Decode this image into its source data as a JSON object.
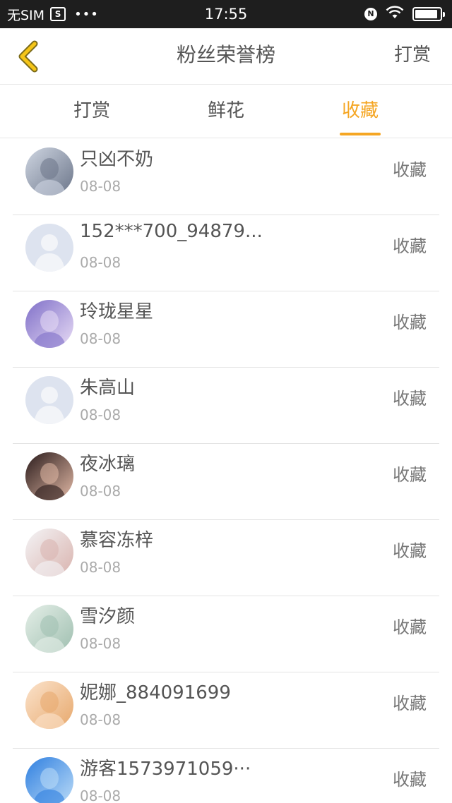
{
  "status_bar": {
    "carrier": "无SIM",
    "sim_icon_text": "S",
    "dots": "•••",
    "time": "17:55",
    "nfc_text": "N",
    "battery_level_percent": 90
  },
  "header": {
    "title": "粉丝荣誉榜",
    "right_action": "打赏",
    "back_icon": "chevron-left-icon",
    "accent_color": "#f5a623"
  },
  "tabs": [
    {
      "label": "打赏",
      "active": false
    },
    {
      "label": "鲜花",
      "active": false
    },
    {
      "label": "收藏",
      "active": true
    }
  ],
  "fans": [
    {
      "name": "只凶不奶",
      "date": "08-08",
      "action": "收藏",
      "avatar": "anime-girl-avatar",
      "avatar_colors": [
        "#cfd6e2",
        "#6b7589"
      ]
    },
    {
      "name": "152***700_94879...",
      "date": "08-08",
      "action": "收藏",
      "avatar": "default-user-avatar",
      "avatar_colors": [
        "#dde3ef",
        "#f2f4f8"
      ]
    },
    {
      "name": "玲珑星星",
      "date": "08-08",
      "action": "收藏",
      "avatar": "anime-girl-avatar",
      "avatar_colors": [
        "#7f6fc8",
        "#e8dcf5"
      ]
    },
    {
      "name": "朱高山",
      "date": "08-08",
      "action": "收藏",
      "avatar": "default-user-avatar",
      "avatar_colors": [
        "#dde3ef",
        "#f2f4f8"
      ]
    },
    {
      "name": "夜冰璃",
      "date": "08-08",
      "action": "收藏",
      "avatar": "dark-portrait-avatar",
      "avatar_colors": [
        "#2a1b1b",
        "#e2b9a6"
      ]
    },
    {
      "name": "慕容冻梓",
      "date": "08-08",
      "action": "收藏",
      "avatar": "girl-portrait-avatar",
      "avatar_colors": [
        "#f4f4f6",
        "#d9b3ae"
      ]
    },
    {
      "name": "雪汐颜",
      "date": "08-08",
      "action": "收藏",
      "avatar": "anime-girl-avatar",
      "avatar_colors": [
        "#e5efe8",
        "#9fbfb0"
      ]
    },
    {
      "name": "妮娜_884091699",
      "date": "08-08",
      "action": "收藏",
      "avatar": "cartoon-girl-avatar",
      "avatar_colors": [
        "#fbe3cc",
        "#e7a86c"
      ]
    },
    {
      "name": "游客1573971059···",
      "date": "08-08",
      "action": "收藏",
      "avatar": "blue-abstract-avatar",
      "avatar_colors": [
        "#2f7fe0",
        "#bcdcf7"
      ]
    }
  ]
}
